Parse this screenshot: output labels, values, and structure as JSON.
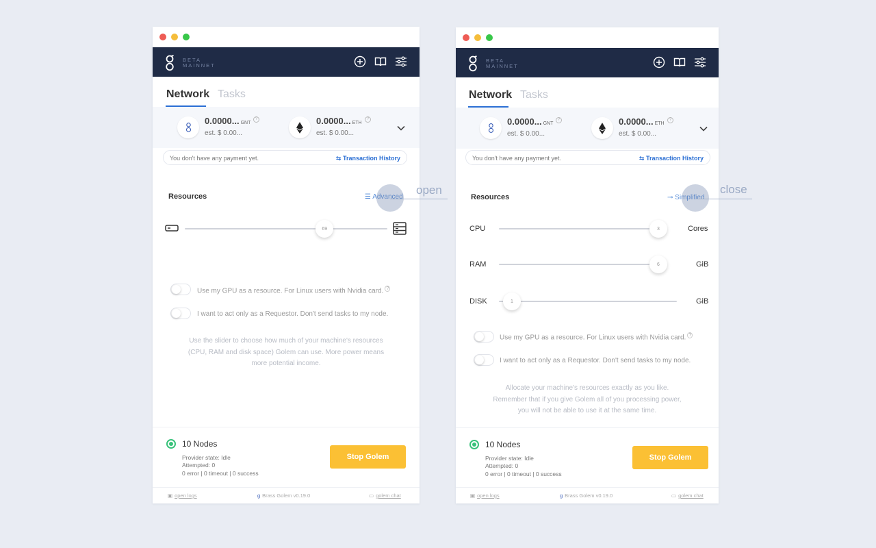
{
  "colors": {
    "header_bg": "#1f2b46",
    "accent": "#2b6fd4",
    "stop_button": "#fbc034",
    "status_green": "#38c27a"
  },
  "left": {
    "header": {
      "beta": "BETA",
      "mainnet": "MAINNET",
      "icons": [
        "plus-circle-icon",
        "book-icon",
        "settings-sliders-icon"
      ]
    },
    "tabs": [
      {
        "label": "Network"
      },
      {
        "label": "Tasks"
      }
    ],
    "balances": [
      {
        "amount": "0.0000...",
        "unit": "GNT",
        "est": "est. $ 0.00..."
      },
      {
        "amount": "0.0000...",
        "unit": "ETH",
        "est": "est. $ 0.00..."
      }
    ],
    "payment": {
      "text": "You don't have any payment yet.",
      "history": "Transaction History"
    },
    "resources": {
      "title": "Resources",
      "toggle": "Advanced",
      "slider_value": "69",
      "slider_fraction": 0.69
    },
    "options": [
      {
        "text": "Use my GPU as a resource. For Linux users with Nvidia card.",
        "hint": "?"
      },
      {
        "text": "I want to act only as a Requestor. Don't send tasks to my node."
      }
    ],
    "info_lines": [
      "Use the slider to choose how much of your machine's resources",
      "(CPU, RAM and disk space) Golem can use. More power means",
      "more potential income."
    ],
    "status": {
      "nodes": "10 Nodes",
      "provider_state": "Provider state: Idle",
      "attempted": "Attempted: 0",
      "counts": "0 error | 0 timeout | 0 success"
    },
    "stop_button": "Stop Golem",
    "footer": {
      "logs": "open logs",
      "version": "Brass Golem v0.19.0",
      "chat": "golem chat"
    }
  },
  "right": {
    "header": {
      "beta": "BETA",
      "mainnet": "MAINNET",
      "icons": [
        "plus-circle-icon",
        "book-icon",
        "settings-sliders-icon"
      ]
    },
    "tabs": [
      {
        "label": "Network"
      },
      {
        "label": "Tasks"
      }
    ],
    "balances": [
      {
        "amount": "0.0000...",
        "unit": "GNT",
        "est": "est. $ 0.00..."
      },
      {
        "amount": "0.0000...",
        "unit": "ETH",
        "est": "est. $ 0.00..."
      }
    ],
    "payment": {
      "text": "You don't have any payment yet.",
      "history": "Transaction History"
    },
    "resources": {
      "title": "Resources",
      "toggle": "Simplified"
    },
    "sliders": [
      {
        "label": "CPU",
        "value": "3",
        "unit": "Cores",
        "fraction": 1.0
      },
      {
        "label": "RAM",
        "value": "6",
        "unit": "GiB",
        "fraction": 1.0
      },
      {
        "label": "DISK",
        "value": "1",
        "unit": "GiB",
        "fraction": 0.0
      }
    ],
    "options": [
      {
        "text": "Use my GPU as a resource. For Linux users with Nvidia card.",
        "hint": "?"
      },
      {
        "text": "I want to act only as a Requestor. Don't send tasks to my node."
      }
    ],
    "info_lines": [
      "Allocate your machine's resources exactly as you like.",
      "Remember that if you give Golem all of you processing power,",
      "you will not be able to use it at the same time."
    ],
    "status": {
      "nodes": "10 Nodes",
      "provider_state": "Provider state: Idle",
      "attempted": "Attempted: 0",
      "counts": "0 error | 0 timeout | 0 success"
    },
    "stop_button": "Stop Golem",
    "footer": {
      "logs": "open logs",
      "version": "Brass Golem v0.19.0",
      "chat": "golem chat"
    }
  },
  "annotations": {
    "open": "open",
    "close": "close"
  }
}
